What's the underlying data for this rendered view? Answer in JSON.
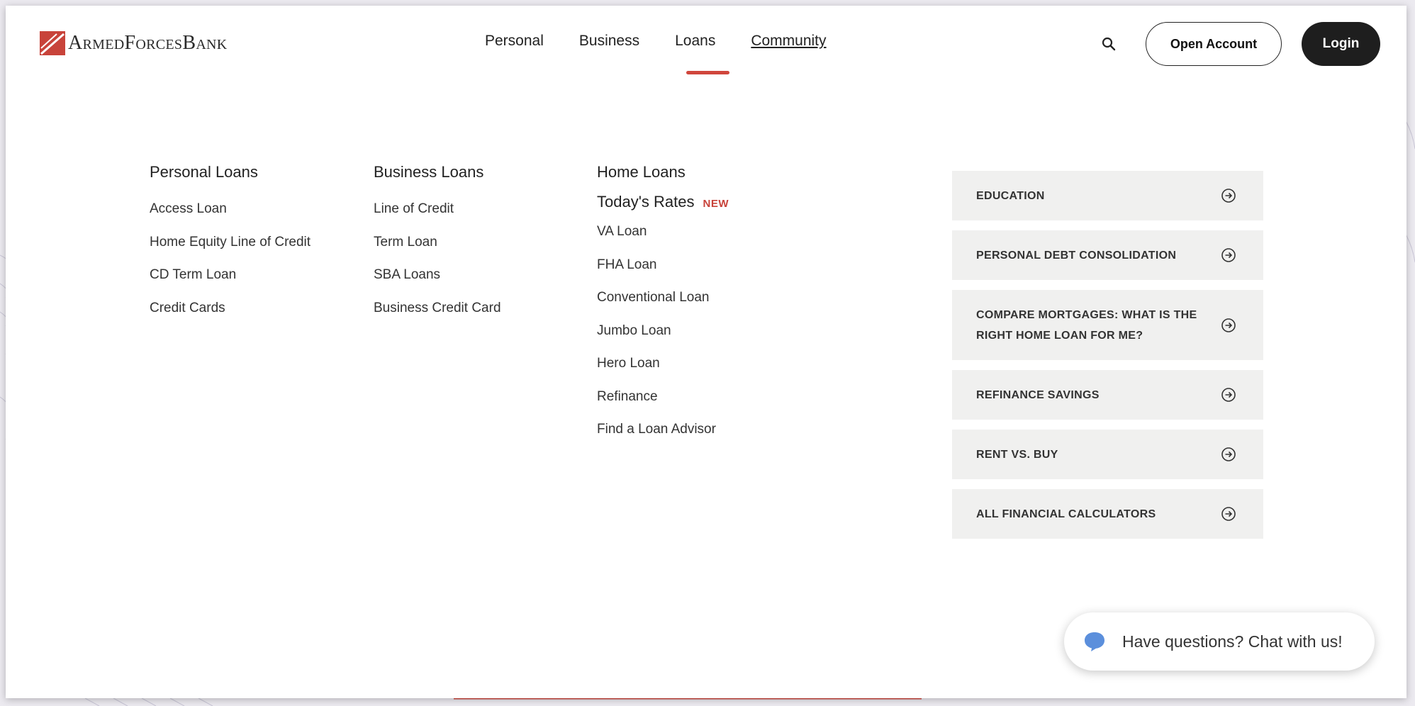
{
  "brand": {
    "name": "ArmedForcesBank",
    "accent_color": "#d0463c"
  },
  "nav": {
    "items": [
      "Personal",
      "Business",
      "Loans",
      "Community"
    ],
    "active": "Loans"
  },
  "header": {
    "open_account_label": "Open Account",
    "login_label": "Login"
  },
  "menu": {
    "personal_loans": {
      "title": "Personal Loans",
      "links": [
        "Access Loan",
        "Home Equity Line of Credit",
        "CD Term Loan",
        "Credit Cards"
      ]
    },
    "business_loans": {
      "title": "Business Loans",
      "links": [
        "Line of Credit",
        "Term Loan",
        "SBA Loans",
        "Business Credit Card"
      ]
    },
    "home_loans": {
      "title": "Home Loans",
      "rates_label": "Today's Rates",
      "rates_badge": "NEW",
      "links": [
        "VA Loan",
        "FHA Loan",
        "Conventional Loan",
        "Jumbo Loan",
        "Hero Loan",
        "Refinance",
        "Find a Loan Advisor"
      ]
    }
  },
  "resources": [
    "EDUCATION",
    "PERSONAL DEBT CONSOLIDATION",
    "COMPARE MORTGAGES: WHAT IS THE RIGHT HOME LOAN FOR ME?",
    "REFINANCE SAVINGS",
    "RENT VS. BUY",
    "ALL FINANCIAL CALCULATORS"
  ],
  "chat": {
    "label": "Have questions? Chat with us!",
    "icon": "chat-bubble-icon"
  },
  "icons": {
    "search": "search-icon",
    "card_arrow": "circle-arrow-right-icon"
  }
}
